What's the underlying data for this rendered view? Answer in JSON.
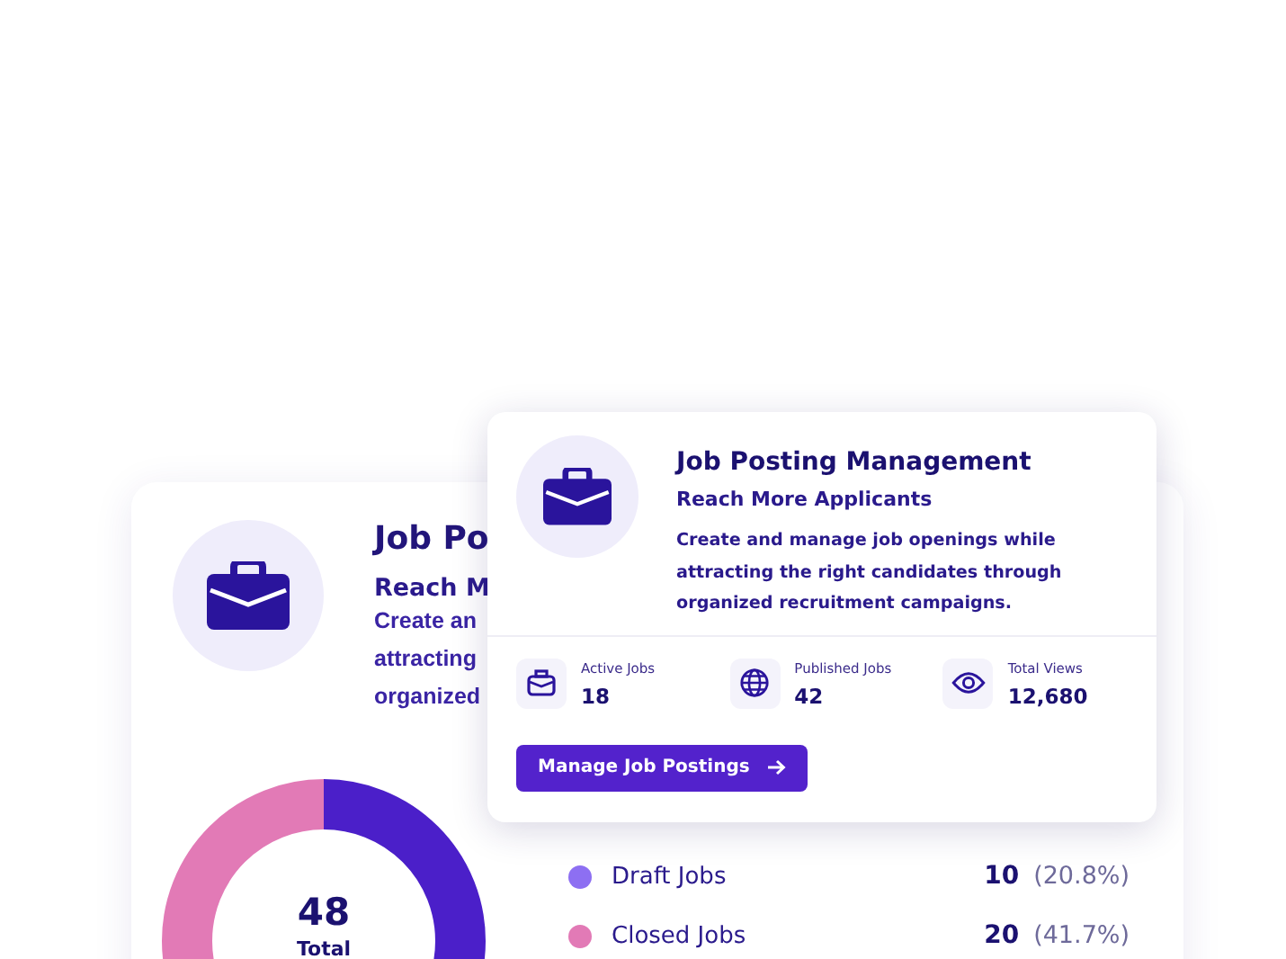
{
  "back_card": {
    "title": "Job Po",
    "subtitle": "Reach M",
    "description_lines": [
      "Create an",
      "attracting",
      "organized"
    ],
    "donut": {
      "total": "48",
      "total_label": "Total"
    },
    "legend": [
      {
        "label": "Draft Jobs",
        "count": "10",
        "percent": "(20.8%)",
        "color": "#8d6ff2"
      },
      {
        "label": "Closed Jobs",
        "count": "20",
        "percent": "(41.7%)",
        "color": "#e27ab6"
      }
    ]
  },
  "front_card": {
    "title": "Job Posting Management",
    "subtitle": "Reach More Applicants",
    "description": "Create and manage job openings while attracting the right candidates through organized recruitment campaigns.",
    "stats": [
      {
        "kind": "briefcase",
        "label": "Active Jobs",
        "value": "18"
      },
      {
        "kind": "globe",
        "label": "Published Jobs",
        "value": "42"
      },
      {
        "kind": "eye",
        "label": "Total Views",
        "value": "12,680"
      }
    ],
    "button": {
      "label": "Manage Job Postings"
    }
  }
}
